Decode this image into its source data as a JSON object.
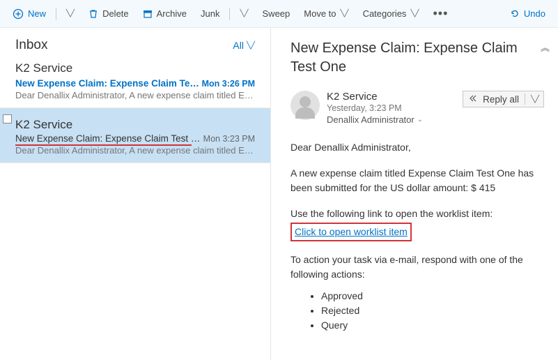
{
  "toolbar": {
    "new": "New",
    "delete": "Delete",
    "archive": "Archive",
    "junk": "Junk",
    "sweep": "Sweep",
    "move_to": "Move to",
    "categories": "Categories",
    "undo": "Undo"
  },
  "list": {
    "header": "Inbox",
    "filter": "All",
    "messages": [
      {
        "from": "K2 Service",
        "subject": "New Expense Claim: Expense Claim Test Two",
        "time": "Mon 3:26 PM",
        "preview": "Dear Denallix Administrator, A new expense claim titled Ex...",
        "unread": true,
        "selected": false
      },
      {
        "from": "K2 Service",
        "subject": "New Expense Claim: Expense Claim Test One",
        "time": "Mon 3:23 PM",
        "preview": "Dear Denallix Administrator, A new expense claim titled Ex...",
        "unread": false,
        "selected": true
      }
    ]
  },
  "reading": {
    "subject": "New Expense Claim: Expense Claim Test One",
    "sender_name": "K2 Service",
    "sent_date": "Yesterday, 3:23 PM",
    "to": "Denallix Administrator",
    "reply_label": "Reply all",
    "body": {
      "greeting": "Dear Denallix Administrator,",
      "p1": "A new expense claim titled Expense Claim Test One has been submitted for the US dollar amount: $ 415",
      "p2": "Use the following link to open the worklist item:",
      "link_text": "Click to open worklist item",
      "p3": "To action your task via e-mail, respond with one of the following actions:",
      "actions": [
        "Approved",
        "Rejected",
        "Query"
      ]
    }
  }
}
